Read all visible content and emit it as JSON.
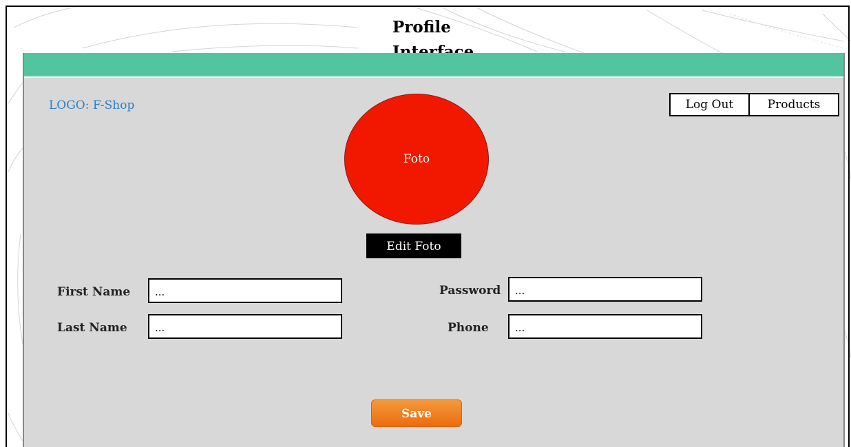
{
  "page": {
    "title": "Profile\nInterface"
  },
  "header": {
    "logo": "LOGO: F-Shop",
    "nav": {
      "logout_label": "Log Out",
      "products_label": "Products"
    }
  },
  "profile": {
    "photo_label": "Foto",
    "edit_photo_label": "Edit Foto"
  },
  "form": {
    "first_name": {
      "label": "First Name",
      "value": "..."
    },
    "last_name": {
      "label": "Last Name",
      "value": "..."
    },
    "password": {
      "label": "Password",
      "value": "..."
    },
    "phone": {
      "label": "Phone",
      "value": "..."
    },
    "save_label": "Save"
  },
  "colors": {
    "window_bar": "#52c5a0",
    "window_bg": "#d8d8d8",
    "logo_text": "#2a7fc9",
    "avatar_fill": "#f21800",
    "save_button": "#ec6c0c"
  }
}
